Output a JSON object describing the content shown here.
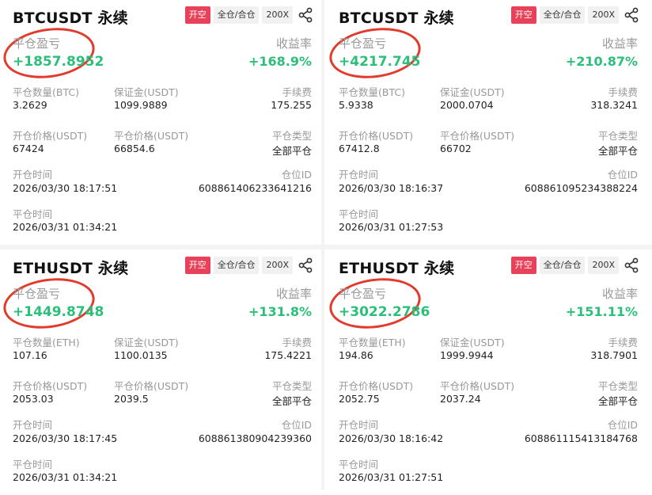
{
  "cards": [
    {
      "symbol": "BTCUSDT 永续",
      "side": "开空",
      "margin_mode": "全仓/合仓",
      "leverage": "200X",
      "pnl_label": "平仓盈亏",
      "pnl": "+1857.8952",
      "roe_label": "收益率",
      "roe": "+168.9%",
      "qty_label": "平仓数量(BTC)",
      "qty": "3.2629",
      "margin_label": "保证金(USDT)",
      "margin": "1099.9889",
      "fee_label": "手续费",
      "fee": "175.255",
      "open_price_label": "开仓价格(USDT)",
      "open_price": "67424",
      "close_price_label": "平仓价格(USDT)",
      "close_price": "66854.6",
      "close_type_label": "平仓类型",
      "close_type": "全部平仓",
      "open_time_label": "开仓时间",
      "open_time": "2026/03/30 18:17:51",
      "pos_id_label": "仓位ID",
      "pos_id": "608861406233641216",
      "close_time_label": "平仓时间",
      "close_time": "2026/03/31 01:34:21"
    },
    {
      "symbol": "BTCUSDT 永续",
      "side": "开空",
      "margin_mode": "全仓/合仓",
      "leverage": "200X",
      "pnl_label": "平仓盈亏",
      "pnl": "+4217.745",
      "roe_label": "收益率",
      "roe": "+210.87%",
      "qty_label": "平仓数量(BTC)",
      "qty": "5.9338",
      "margin_label": "保证金(USDT)",
      "margin": "2000.0704",
      "fee_label": "手续费",
      "fee": "318.3241",
      "open_price_label": "开仓价格(USDT)",
      "open_price": "67412.8",
      "close_price_label": "平仓价格(USDT)",
      "close_price": "66702",
      "close_type_label": "平仓类型",
      "close_type": "全部平仓",
      "open_time_label": "开仓时间",
      "open_time": "2026/03/30 18:16:37",
      "pos_id_label": "仓位ID",
      "pos_id": "608861095234388224",
      "close_time_label": "平仓时间",
      "close_time": "2026/03/31 01:27:53"
    },
    {
      "symbol": "ETHUSDT 永续",
      "side": "开空",
      "margin_mode": "全仓/合仓",
      "leverage": "200X",
      "pnl_label": "平仓盈亏",
      "pnl": "+1449.8748",
      "roe_label": "收益率",
      "roe": "+131.8%",
      "qty_label": "平仓数量(ETH)",
      "qty": "107.16",
      "margin_label": "保证金(USDT)",
      "margin": "1100.0135",
      "fee_label": "手续费",
      "fee": "175.4221",
      "open_price_label": "开仓价格(USDT)",
      "open_price": "2053.03",
      "close_price_label": "平仓价格(USDT)",
      "close_price": "2039.5",
      "close_type_label": "平仓类型",
      "close_type": "全部平仓",
      "open_time_label": "开仓时间",
      "open_time": "2026/03/30 18:17:45",
      "pos_id_label": "仓位ID",
      "pos_id": "608861380904239360",
      "close_time_label": "平仓时间",
      "close_time": "2026/03/31 01:34:21"
    },
    {
      "symbol": "ETHUSDT 永续",
      "side": "开空",
      "margin_mode": "全仓/合仓",
      "leverage": "200X",
      "pnl_label": "平仓盈亏",
      "pnl": "+3022.2786",
      "roe_label": "收益率",
      "roe": "+151.11%",
      "qty_label": "平仓数量(ETH)",
      "qty": "194.86",
      "margin_label": "保证金(USDT)",
      "margin": "1999.9944",
      "fee_label": "手续费",
      "fee": "318.7901",
      "open_price_label": "开仓价格(USDT)",
      "open_price": "2052.75",
      "close_price_label": "平仓价格(USDT)",
      "close_price": "2037.24",
      "close_type_label": "平仓类型",
      "close_type": "全部平仓",
      "open_time_label": "开仓时间",
      "open_time": "2026/03/30 18:16:42",
      "pos_id_label": "仓位ID",
      "pos_id": "608861115413184768",
      "close_time_label": "平仓时间",
      "close_time": "2026/03/31 01:27:51"
    }
  ],
  "colors": {
    "profit": "#2cbf7a",
    "side_tag": "#e8425a",
    "annotation_ring": "#e23b2c"
  },
  "icons": {
    "share": "share-icon"
  }
}
